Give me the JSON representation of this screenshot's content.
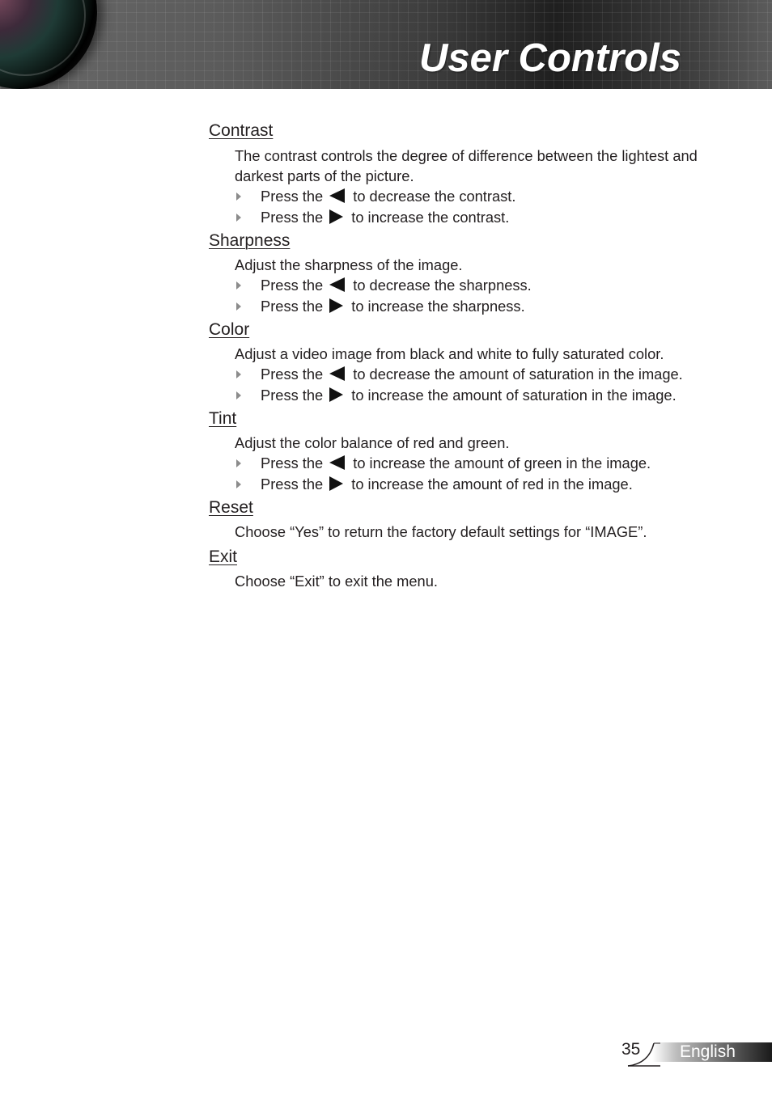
{
  "header": {
    "title": "User Controls"
  },
  "sections": [
    {
      "heading": "Contrast",
      "description": "The contrast controls the degree of difference between the lightest and darkest parts of the picture.",
      "bullets": [
        {
          "prefix": "Press the",
          "key_icon": "left-arrow-icon",
          "suffix": "to decrease the contrast."
        },
        {
          "prefix": "Press the",
          "key_icon": "right-arrow-icon",
          "suffix": "to increase the contrast."
        }
      ]
    },
    {
      "heading": "Sharpness",
      "description": "Adjust the sharpness of the image.",
      "bullets": [
        {
          "prefix": "Press the",
          "key_icon": "left-arrow-icon",
          "suffix": "to decrease the sharpness."
        },
        {
          "prefix": "Press the",
          "key_icon": "right-arrow-icon",
          "suffix": "to increase the sharpness."
        }
      ]
    },
    {
      "heading": "Color",
      "description": "Adjust a video image from black and white to fully saturated color.",
      "bullets": [
        {
          "prefix": "Press the",
          "key_icon": "left-arrow-icon",
          "suffix": "to decrease the amount of saturation in the image."
        },
        {
          "prefix": "Press the",
          "key_icon": "right-arrow-icon",
          "suffix": "to increase the amount of saturation in the image."
        }
      ]
    },
    {
      "heading": "Tint",
      "description": "Adjust the color balance of red and green.",
      "bullets": [
        {
          "prefix": "Press the",
          "key_icon": "left-arrow-icon",
          "suffix": "to increase the amount of green in the image."
        },
        {
          "prefix": "Press the",
          "key_icon": "right-arrow-icon",
          "suffix": "to increase the amount of red in the image."
        }
      ]
    },
    {
      "heading": "Reset",
      "description": "Choose “Yes” to return the factory default settings for “IMAGE”."
    },
    {
      "heading": "Exit",
      "description": "Choose “Exit” to exit the menu."
    }
  ],
  "footer": {
    "page_number": "35",
    "language": "English"
  }
}
